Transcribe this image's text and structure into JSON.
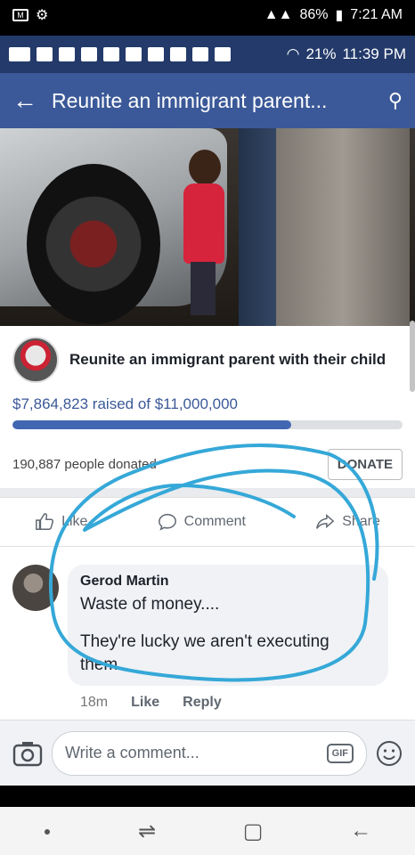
{
  "outer_status": {
    "battery": "86%",
    "time": "7:21 AM"
  },
  "inner_status": {
    "battery": "21%",
    "time": "11:39 PM"
  },
  "appbar": {
    "title": "Reunite an immigrant parent..."
  },
  "fundraiser": {
    "title": "Reunite an immigrant parent with their child",
    "raised_text": "$7,864,823 raised of $11,000,000",
    "progress_fraction": 0.715,
    "donors_text": "190,887 people donated",
    "donate_label": "DONATE"
  },
  "actions": {
    "like": "Like",
    "comment": "Comment",
    "share": "Share"
  },
  "comment": {
    "author": "Gerod Martin",
    "line1": "Waste of money....",
    "line2": "They're lucky we aren't executing them.",
    "time": "18m",
    "like": "Like",
    "reply": "Reply"
  },
  "writebar": {
    "placeholder": "Write a comment...",
    "gif": "GIF"
  },
  "colors": {
    "facebook_blue": "#3b5998",
    "scribble": "#35a8d8"
  }
}
